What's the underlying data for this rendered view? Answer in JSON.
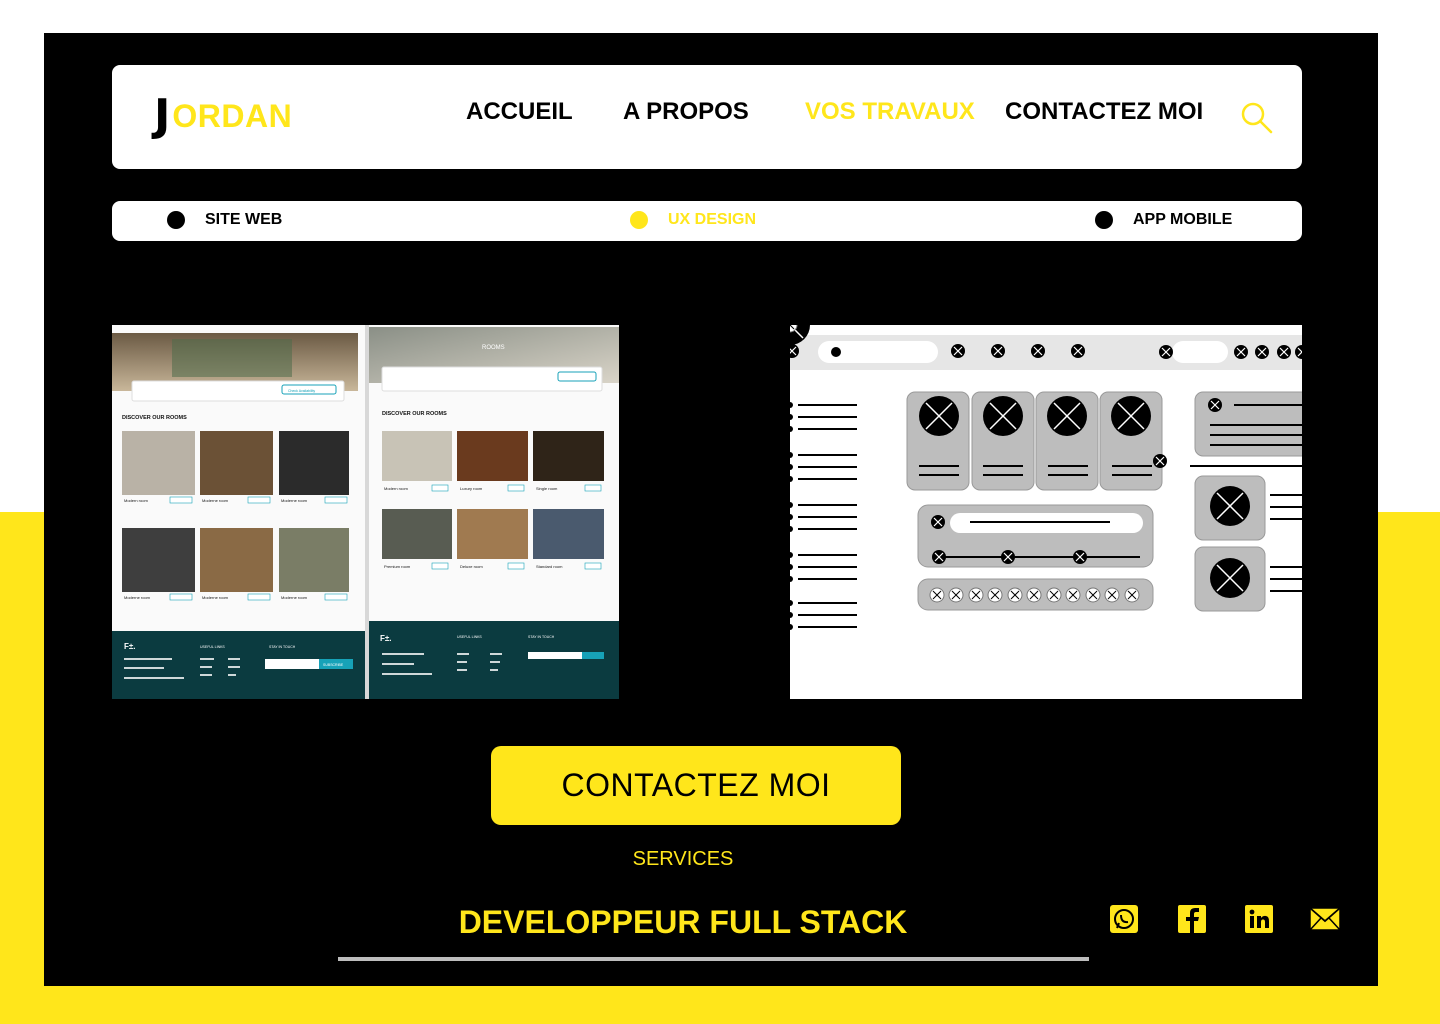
{
  "brand": {
    "initial": "J",
    "rest": "ORDAN"
  },
  "nav": {
    "items": [
      {
        "label": "ACCUEIL"
      },
      {
        "label": "A PROPOS"
      },
      {
        "label": "VOS TRAVAUX"
      },
      {
        "label": "CONTACTEZ MOI"
      }
    ],
    "active_index": 2
  },
  "filters": [
    {
      "label": "SITE WEB"
    },
    {
      "label": "UX DESIGN"
    },
    {
      "label": "APP MOBILE"
    }
  ],
  "active_filter": "UX DESIGN",
  "projects": [
    {
      "type": "hotel-website-screenshot",
      "texts": {
        "rooms_heading": "ROOMS",
        "discover": "DISCOVER OUR ROOMS",
        "check_availability": "Check Availability",
        "useful_links": "USEFUL LINKS",
        "stay_in_touch": "STAY IN TOUCH",
        "subscribe": "SUBSCRIBE",
        "room_names_left": [
          "Modern room",
          "Moderne room",
          "Moderne room",
          "Moderne room",
          "Moderne room",
          "Moderne room"
        ],
        "room_names_right": [
          "Modern room",
          "Luxury room",
          "Single room",
          "Premium room",
          "Deluxe room",
          "Standard room"
        ],
        "footer_logo": "F±."
      }
    },
    {
      "type": "ux-wireframe"
    }
  ],
  "cta": {
    "label": "CONTACTEZ MOI"
  },
  "services_label": "SERVICES",
  "role_label": "DEVELOPPEUR FULL STACK",
  "social": [
    "whatsapp-icon",
    "facebook-icon",
    "linkedin-icon",
    "mail-icon"
  ],
  "colors": {
    "accent": "#FFE61B",
    "frame": "#000000",
    "mock_footer": "#0b3b40",
    "mock_teal": "#17a2b8"
  }
}
